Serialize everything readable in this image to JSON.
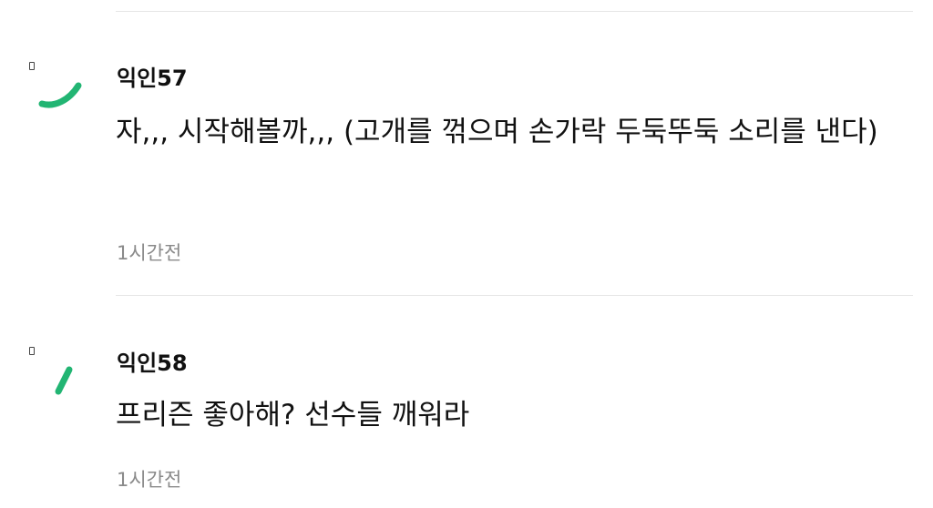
{
  "comments": [
    {
      "author": "익인57",
      "text": "자,,, 시작해볼까,,, (고개를 꺾으며 손가락 두둑뚜둑 소리를 낸다)",
      "time": "1시간전"
    },
    {
      "author": "익인58",
      "text": "프리즌 좋아해? 선수들 깨워라",
      "time": "1시간전"
    }
  ],
  "colors": {
    "accent": "#22b573",
    "divider": "#e6e6e6",
    "meta_text": "#8a8a8a"
  }
}
